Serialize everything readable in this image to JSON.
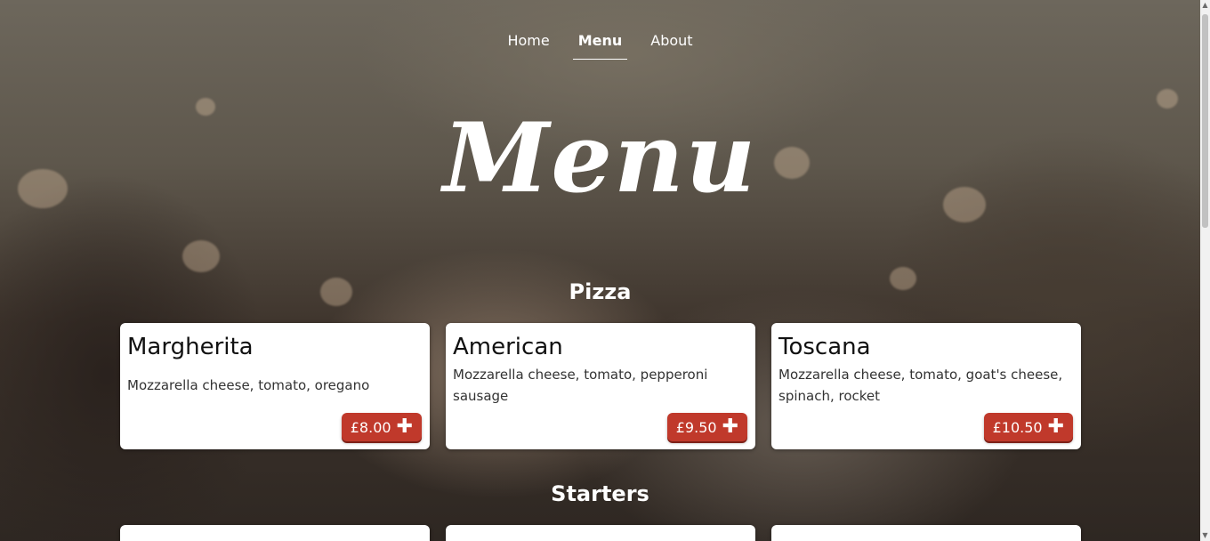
{
  "nav": {
    "items": [
      {
        "label": "Home"
      },
      {
        "label": "Menu"
      },
      {
        "label": "About"
      }
    ]
  },
  "hero": {
    "title": "Menu"
  },
  "sections": [
    {
      "title": "Pizza",
      "items": [
        {
          "name": "Margherita",
          "desc": "Mozzarella cheese, tomato, oregano",
          "price": "£8.00"
        },
        {
          "name": "American",
          "desc": "Mozzarella cheese, tomato, pepperoni sausage",
          "price": "£9.50"
        },
        {
          "name": "Toscana",
          "desc": "Mozzarella cheese, tomato, goat's cheese, spinach, rocket",
          "price": "£10.50"
        }
      ]
    },
    {
      "title": "Starters",
      "items": []
    }
  ],
  "icons": {
    "add": "plus-icon"
  },
  "colors": {
    "accent": "#c0392b",
    "card": "#ffffff",
    "text": "#ffffff"
  }
}
